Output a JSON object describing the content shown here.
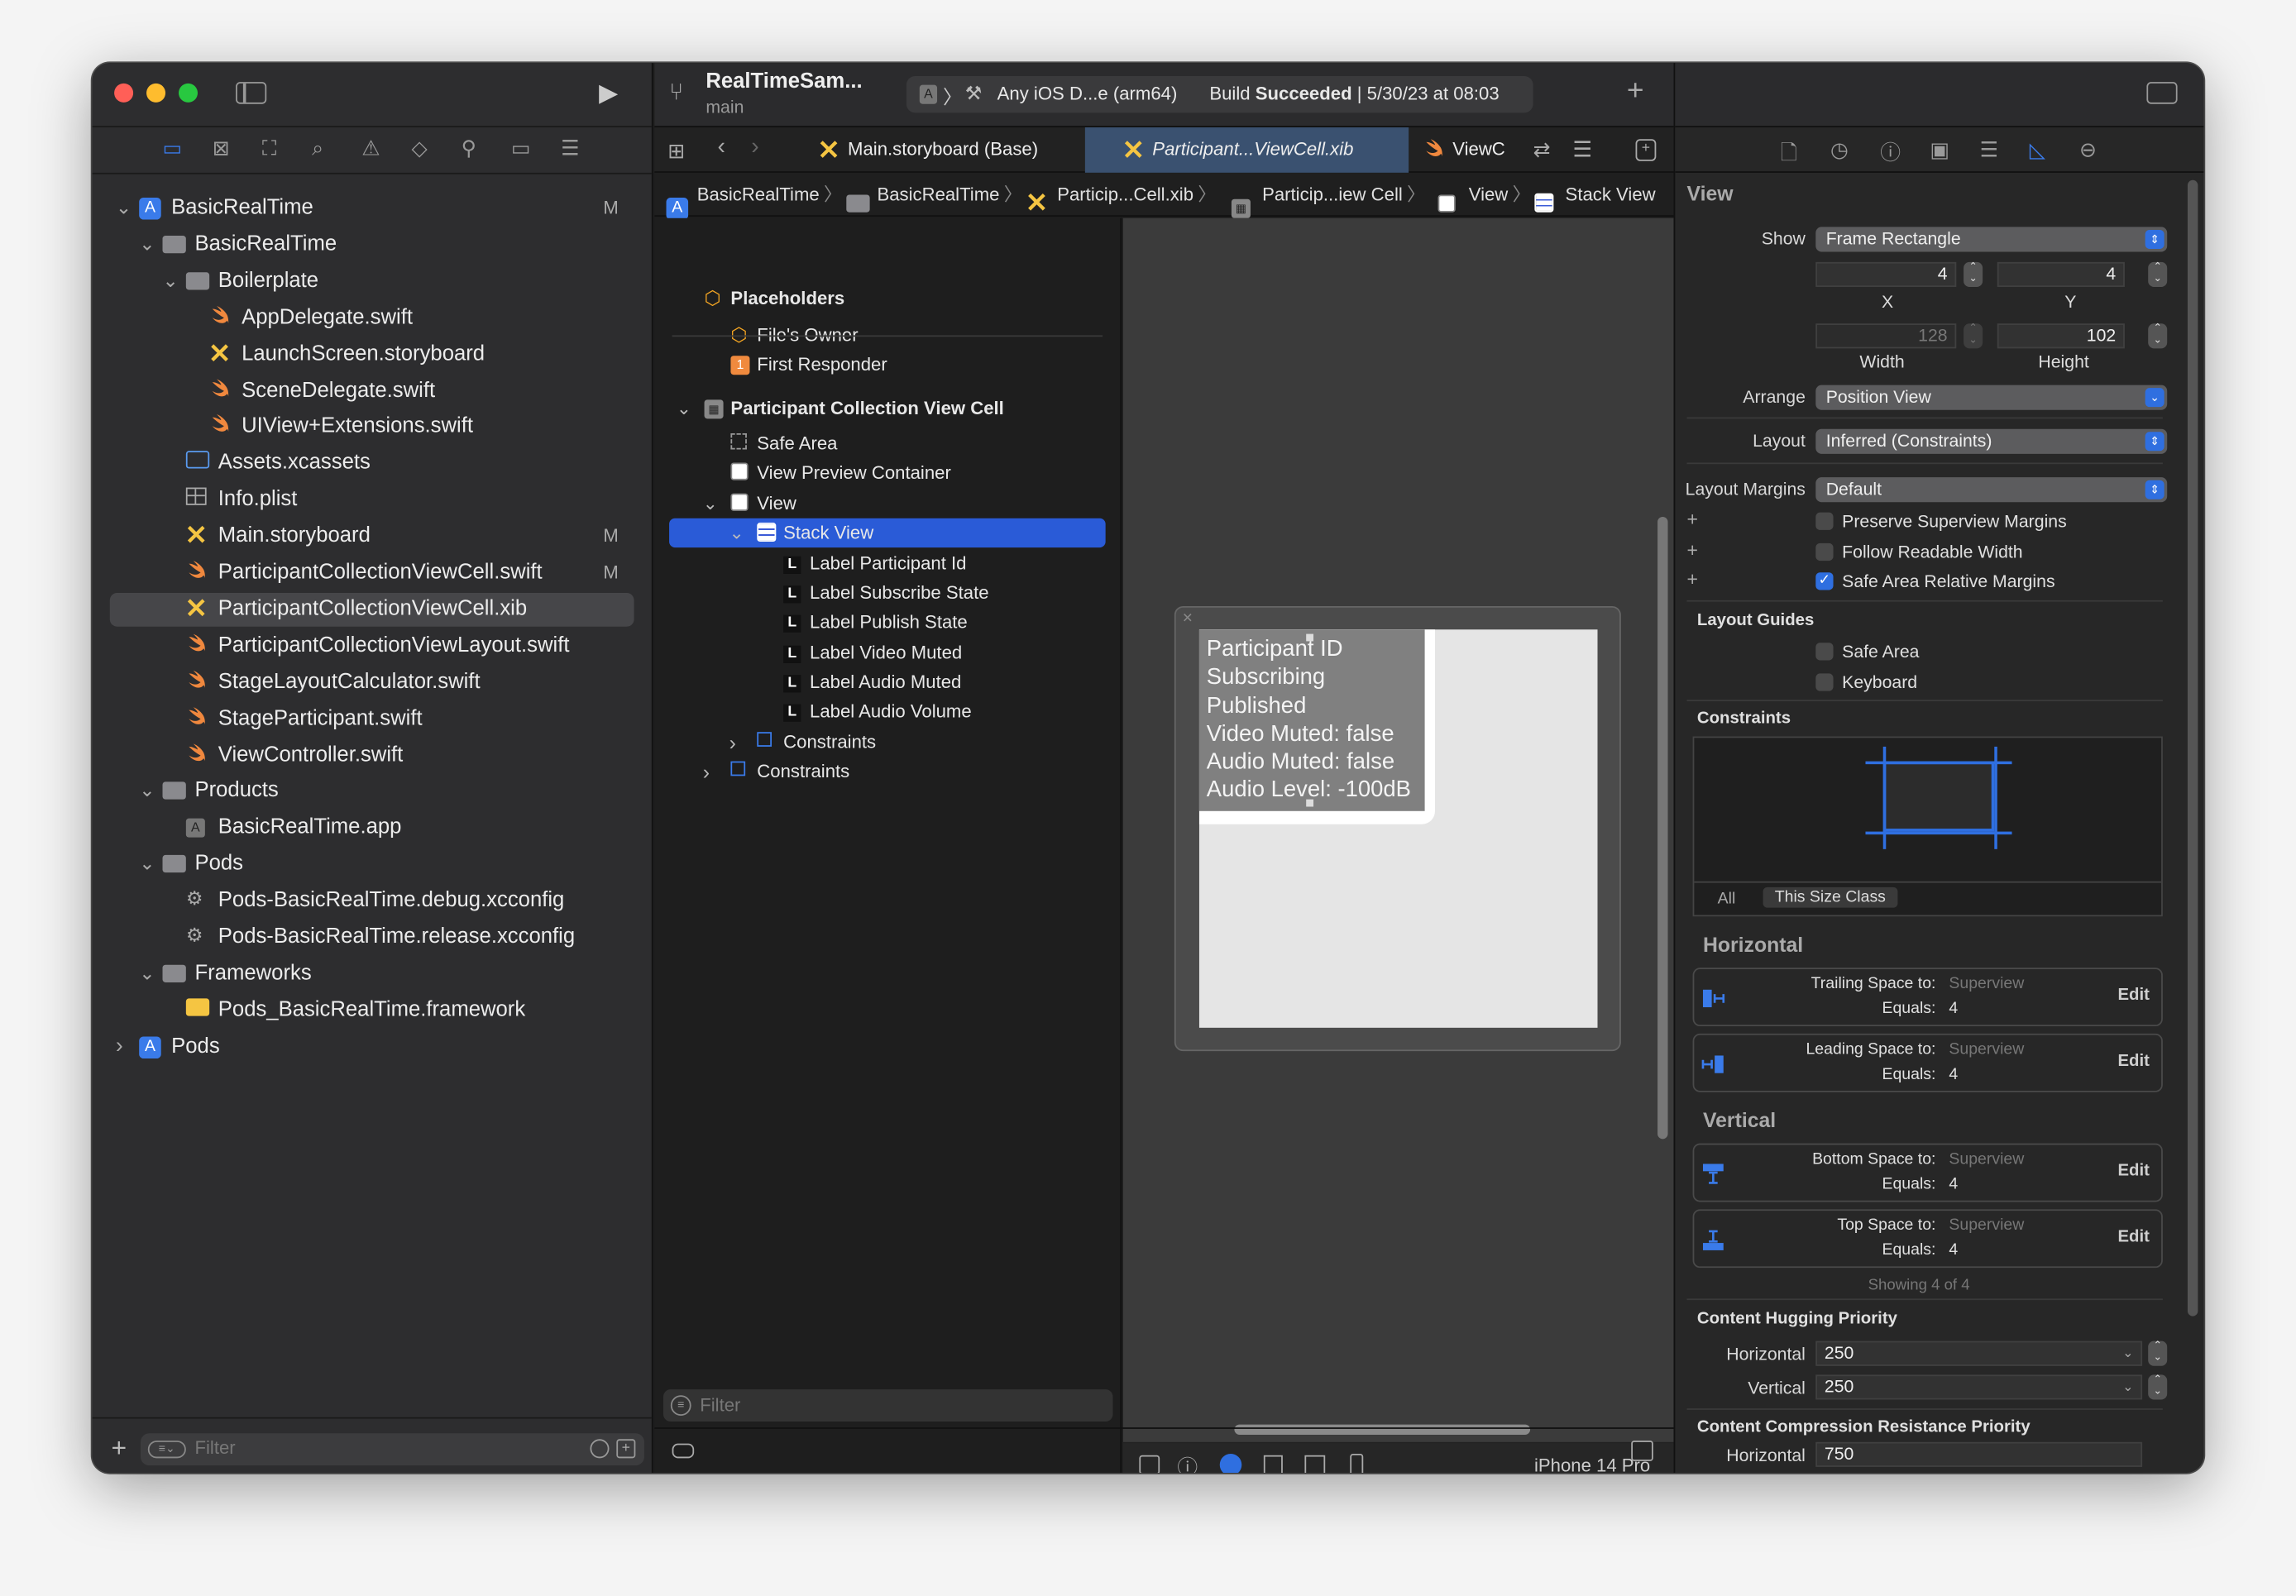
{
  "window": {
    "traffic_lights": [
      "#ff5f57",
      "#febc2e",
      "#28c840"
    ]
  },
  "toolbar": {
    "project_name": "RealTimeSam...",
    "branch": "main",
    "scheme_destination": "Any iOS D...e (arm64)",
    "build_prefix": "Build",
    "build_status": "Succeeded",
    "build_time": "| 5/30/23 at 08:03",
    "add_icon": "+"
  },
  "navigator": {
    "items": [
      {
        "label": "BasicRealTime",
        "icon": "project",
        "depth": 0,
        "state": "open",
        "badge": "M"
      },
      {
        "label": "BasicRealTime",
        "icon": "folder",
        "depth": 1,
        "state": "open"
      },
      {
        "label": "Boilerplate",
        "icon": "folder",
        "depth": 2,
        "state": "open"
      },
      {
        "label": "AppDelegate.swift",
        "icon": "swift",
        "depth": 3
      },
      {
        "label": "LaunchScreen.storyboard",
        "icon": "storyboard",
        "depth": 3
      },
      {
        "label": "SceneDelegate.swift",
        "icon": "swift",
        "depth": 3
      },
      {
        "label": "UIView+Extensions.swift",
        "icon": "swift",
        "depth": 3
      },
      {
        "label": "Assets.xcassets",
        "icon": "assets",
        "depth": 2
      },
      {
        "label": "Info.plist",
        "icon": "plist",
        "depth": 2
      },
      {
        "label": "Main.storyboard",
        "icon": "storyboard",
        "depth": 2,
        "badge": "M"
      },
      {
        "label": "ParticipantCollectionViewCell.swift",
        "icon": "swift",
        "depth": 2,
        "badge": "M"
      },
      {
        "label": "ParticipantCollectionViewCell.xib",
        "icon": "storyboard",
        "depth": 2,
        "selected": true
      },
      {
        "label": "ParticipantCollectionViewLayout.swift",
        "icon": "swift",
        "depth": 2
      },
      {
        "label": "StageLayoutCalculator.swift",
        "icon": "swift",
        "depth": 2
      },
      {
        "label": "StageParticipant.swift",
        "icon": "swift",
        "depth": 2
      },
      {
        "label": "ViewController.swift",
        "icon": "swift",
        "depth": 2
      },
      {
        "label": "Products",
        "icon": "folder",
        "depth": 1,
        "state": "open"
      },
      {
        "label": "BasicRealTime.app",
        "icon": "app",
        "depth": 2
      },
      {
        "label": "Pods",
        "icon": "folder",
        "depth": 1,
        "state": "open"
      },
      {
        "label": "Pods-BasicRealTime.debug.xcconfig",
        "icon": "xcconfig",
        "depth": 2
      },
      {
        "label": "Pods-BasicRealTime.release.xcconfig",
        "icon": "xcconfig",
        "depth": 2
      },
      {
        "label": "Frameworks",
        "icon": "folder",
        "depth": 1,
        "state": "open"
      },
      {
        "label": "Pods_BasicRealTime.framework",
        "icon": "framework",
        "depth": 2
      },
      {
        "label": "Pods",
        "icon": "project",
        "depth": 0,
        "state": "closed"
      }
    ],
    "filter_placeholder": "Filter"
  },
  "tabs": [
    {
      "label": "Main.storyboard (Base)",
      "icon": "storyboard"
    },
    {
      "label": "Participant...ViewCell.xib",
      "icon": "storyboard",
      "active": true
    },
    {
      "label": "ViewC",
      "icon": "swift"
    }
  ],
  "jumpbar": [
    {
      "label": "BasicRealTime",
      "icon": "project"
    },
    {
      "label": "BasicRealTime",
      "icon": "folder"
    },
    {
      "label": "Particip...Cell.xib",
      "icon": "storyboard"
    },
    {
      "label": "Particip...iew Cell",
      "icon": "collection-cell"
    },
    {
      "label": "View",
      "icon": "view"
    },
    {
      "label": "Stack View",
      "icon": "stack-view"
    }
  ],
  "outline": {
    "items": [
      {
        "label": "Placeholders",
        "icon": "cube",
        "depth": 0,
        "bold": true
      },
      {
        "label": "File's Owner",
        "icon": "cube",
        "depth": 1
      },
      {
        "label": "First Responder",
        "icon": "first-responder",
        "depth": 1
      },
      {
        "label": "Participant Collection View Cell",
        "icon": "collection-cell",
        "depth": 0,
        "state": "open",
        "bold": true
      },
      {
        "label": "Safe Area",
        "icon": "safe-area",
        "depth": 1
      },
      {
        "label": "View Preview Container",
        "icon": "view",
        "depth": 1
      },
      {
        "label": "View",
        "icon": "view",
        "depth": 1,
        "state": "open"
      },
      {
        "label": "Stack View",
        "icon": "stack-view",
        "depth": 2,
        "state": "open",
        "selected": true
      },
      {
        "label": "Label Participant Id",
        "icon": "label",
        "depth": 3
      },
      {
        "label": "Label Subscribe State",
        "icon": "label",
        "depth": 3
      },
      {
        "label": "Label Publish State",
        "icon": "label",
        "depth": 3
      },
      {
        "label": "Label Video Muted",
        "icon": "label",
        "depth": 3
      },
      {
        "label": "Label Audio Muted",
        "icon": "label",
        "depth": 3
      },
      {
        "label": "Label Audio Volume",
        "icon": "label",
        "depth": 3
      },
      {
        "label": "Constraints",
        "icon": "constraints",
        "depth": 2,
        "state": "closed"
      },
      {
        "label": "Constraints",
        "icon": "constraints",
        "depth": 1,
        "state": "closed"
      }
    ],
    "filter_placeholder": "Filter"
  },
  "canvas": {
    "labels": [
      "Participant ID",
      "Subscribing",
      "Published",
      "Video Muted: false",
      "Audio Muted: false",
      "Audio Level: -100dB"
    ],
    "device": "iPhone 14 Pro"
  },
  "inspector": {
    "title": "View",
    "show_label": "Show",
    "show_value": "Frame Rectangle",
    "x_value": "4",
    "x_label": "X",
    "y_value": "4",
    "y_label": "Y",
    "width_value": "128",
    "width_label": "Width",
    "height_value": "102",
    "height_label": "Height",
    "arrange_label": "Arrange",
    "arrange_value": "Position View",
    "layout_label": "Layout",
    "layout_value": "Inferred (Constraints)",
    "margins_label": "Layout Margins",
    "margins_value": "Default",
    "margin_checks": [
      {
        "label": "Preserve Superview Margins",
        "checked": false
      },
      {
        "label": "Follow Readable Width",
        "checked": false
      },
      {
        "label": "Safe Area Relative Margins",
        "checked": true
      }
    ],
    "guides_title": "Layout Guides",
    "guides": [
      {
        "label": "Safe Area",
        "checked": false
      },
      {
        "label": "Keyboard",
        "checked": false
      }
    ],
    "constraints_title": "Constraints",
    "constraint_tabs": [
      "All",
      "This Size Class"
    ],
    "horizontal_title": "Horizontal",
    "vertical_title": "Vertical",
    "constraints": [
      {
        "kind": "Trailing Space to:",
        "target": "Superview",
        "equals_label": "Equals:",
        "value": "4",
        "icon": "trailing-space",
        "edit": "Edit"
      },
      {
        "kind": "Leading Space to:",
        "target": "Superview",
        "equals_label": "Equals:",
        "value": "4",
        "icon": "leading-space",
        "edit": "Edit"
      },
      {
        "kind": "Bottom Space to:",
        "target": "Superview",
        "equals_label": "Equals:",
        "value": "4",
        "icon": "bottom-space",
        "edit": "Edit"
      },
      {
        "kind": "Top Space to:",
        "target": "Superview",
        "equals_label": "Equals:",
        "value": "4",
        "icon": "top-space",
        "edit": "Edit"
      }
    ],
    "showing": "Showing 4 of 4",
    "hugging_title": "Content Hugging Priority",
    "hugging_h_label": "Horizontal",
    "hugging_h": "250",
    "hugging_v_label": "Vertical",
    "hugging_v": "250",
    "compression_title": "Content Compression Resistance Priority",
    "compression_h_label": "Horizontal",
    "compression_h": "750"
  },
  "colors": {
    "accent": "#2f6fe0",
    "selection": "#2a5bd7",
    "swift": "#f0883e",
    "storyboard": "#f5c542"
  }
}
